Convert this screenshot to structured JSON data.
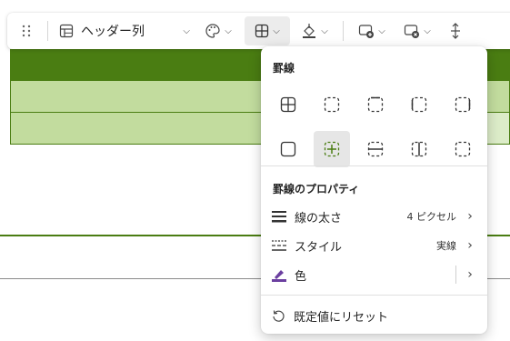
{
  "toolbar": {
    "header_column_label": "ヘッダー列"
  },
  "panel": {
    "borders_title": "罫線",
    "border_properties_title": "罫線のプロパティ",
    "line_width_label": "線の太さ",
    "line_width_value": "4 ピクセル",
    "style_label": "スタイル",
    "style_value": "実線",
    "color_label": "色",
    "reset_label": "既定値にリセット",
    "selected_border": "inner-borders"
  },
  "colors": {
    "accent_green": "#4a7d12",
    "band_green": "#c2dc9e",
    "color_swatch": "#6b3fa0"
  }
}
